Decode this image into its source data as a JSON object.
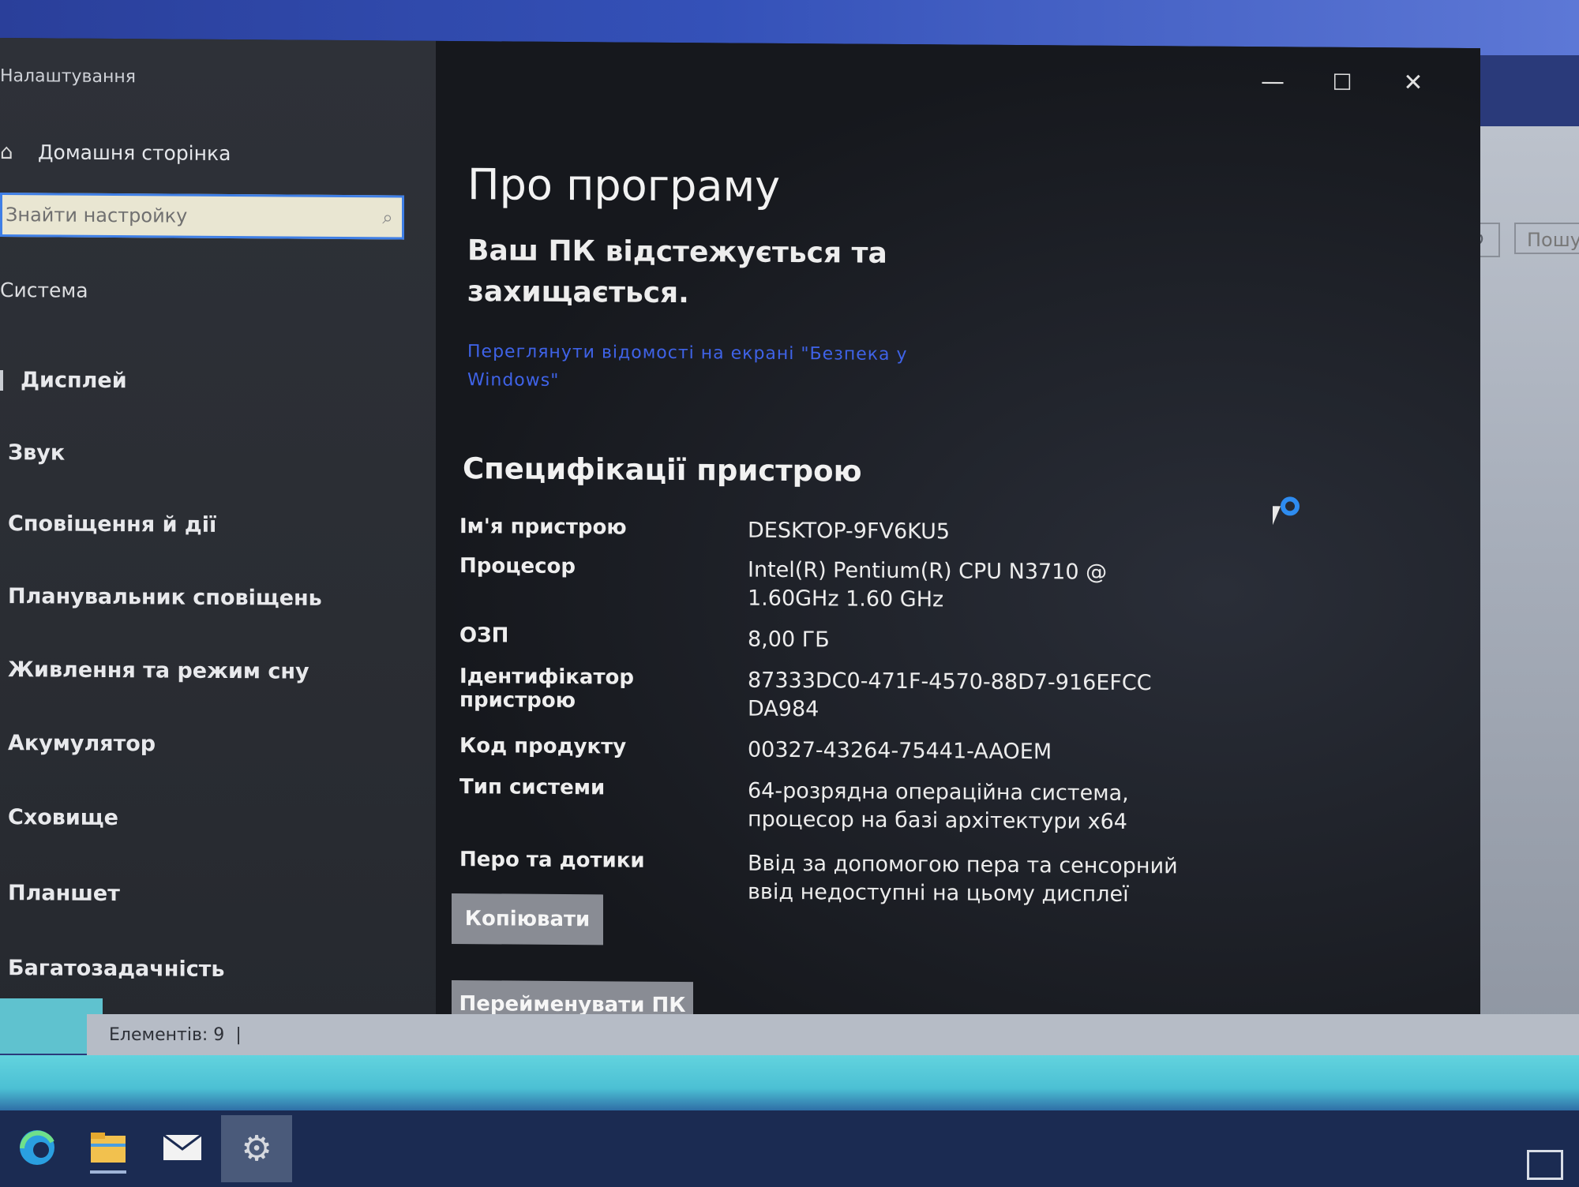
{
  "app": {
    "title": "Налаштування"
  },
  "sidebar": {
    "home_label": "Домашня сторінка",
    "search_placeholder": "Знайти настройку",
    "section": "Система",
    "items": [
      {
        "label": "Дисплей"
      },
      {
        "label": "Звук"
      },
      {
        "label": "Сповіщення й дії"
      },
      {
        "label": "Планувальник сповіщень"
      },
      {
        "label": "Живлення та режим сну"
      },
      {
        "label": "Акумулятор"
      },
      {
        "label": "Сховище"
      },
      {
        "label": "Планшет"
      },
      {
        "label": "Багатозадачність"
      }
    ]
  },
  "main": {
    "title": "Про програму",
    "protection": "Ваш ПК відстежується та захищається.",
    "security_link": "Переглянути відомості на екрані \"Безпека у Windows\"",
    "specs_title": "Специфікації пристрою",
    "specs": [
      {
        "key": "Ім'я пристрою",
        "value": "DESKTOP-9FV6KU5"
      },
      {
        "key": "Процесор",
        "value": "Intel(R) Pentium(R) CPU  N3710  @ 1.60GHz   1.60 GHz"
      },
      {
        "key": "ОЗП",
        "value": "8,00 ГБ"
      },
      {
        "key": "Ідентифікатор пристрою",
        "value": "87333DC0-471F-4570-88D7-916EFCCDA984"
      },
      {
        "key": "Код продукту",
        "value": "00327-43264-75441-AAOEM"
      },
      {
        "key": "Тип системи",
        "value": "64-розрядна операційна система, процесор на базі архітектури x64"
      },
      {
        "key": "Перо та дотики",
        "value": "Ввід за допомогою пера та сенсорний ввід недоступні на цьому дисплеї"
      }
    ],
    "copy_button": "Копіювати",
    "rename_button": "Перейменувати ПК"
  },
  "window_controls": {
    "minimize": "—",
    "maximize": "☐",
    "close": "✕"
  },
  "background_window": {
    "search_label": "Пошу"
  },
  "status_bar": {
    "items_count": "Елементів: 9"
  },
  "taskbar": {
    "icons": [
      "edge-icon",
      "file-explorer-icon",
      "mail-icon",
      "settings-icon",
      "news-icon"
    ]
  },
  "colors": {
    "accent": "#3f7fe6",
    "link": "#3f63e8",
    "button": "#898c94"
  }
}
